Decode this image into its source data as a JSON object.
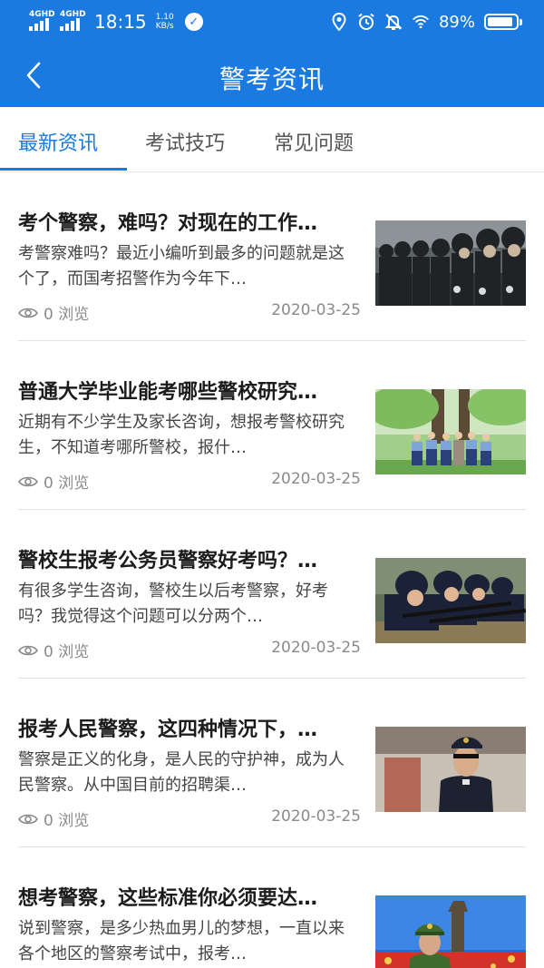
{
  "status_bar": {
    "network_1": "4GHD",
    "network_2": "4GHD",
    "time": "18:15",
    "speed_value": "1.10",
    "speed_unit": "KB/s",
    "battery": "89%",
    "battery_level": 0.89,
    "icons": [
      "signal-icon",
      "check-badge-icon",
      "location-icon",
      "alarm-icon",
      "mute-bell-icon",
      "wifi-icon",
      "battery-icon"
    ]
  },
  "nav": {
    "title": "警考资讯",
    "back_icon": "chevron-left-icon"
  },
  "tabs": [
    {
      "label": "最新资讯",
      "active": true
    },
    {
      "label": "考试技巧",
      "active": false
    },
    {
      "label": "常见问题",
      "active": false
    }
  ],
  "articles": [
    {
      "title": "考个警察，难吗？对现在的工作…",
      "summary": "考警察难吗？最近小编听到最多的问题就是这个了，而国考招警作为今年下…",
      "views": "0 浏览",
      "date": "2020-03-25"
    },
    {
      "title": "普通大学毕业能考哪些警校研究…",
      "summary": "近期有不少学生及家长咨询，想报考警校研究生，不知道考哪所警校，报什…",
      "views": "0 浏览",
      "date": "2020-03-25"
    },
    {
      "title": "警校生报考公务员警察好考吗？…",
      "summary": "有很多学生咨询，警校生以后考警察，好考吗？我觉得这个问题可以分两个…",
      "views": "0 浏览",
      "date": "2020-03-25"
    },
    {
      "title": "报考人民警察，这四种情况下，…",
      "summary": "警察是正义的化身，是人民的守护神，成为人民警察。从中国目前的招聘渠…",
      "views": "0 浏览",
      "date": "2020-03-25"
    },
    {
      "title": "想考警察，这些标准你必须要达…",
      "summary": "说到警察，是多少热血男儿的梦想，一直以来各个地区的警察考试中，报考…",
      "views": "",
      "date": ""
    }
  ],
  "colors": {
    "brand_blue": "#1a7ae0",
    "text_dark": "#1c1c1c",
    "text_muted": "#8a8a8a"
  }
}
